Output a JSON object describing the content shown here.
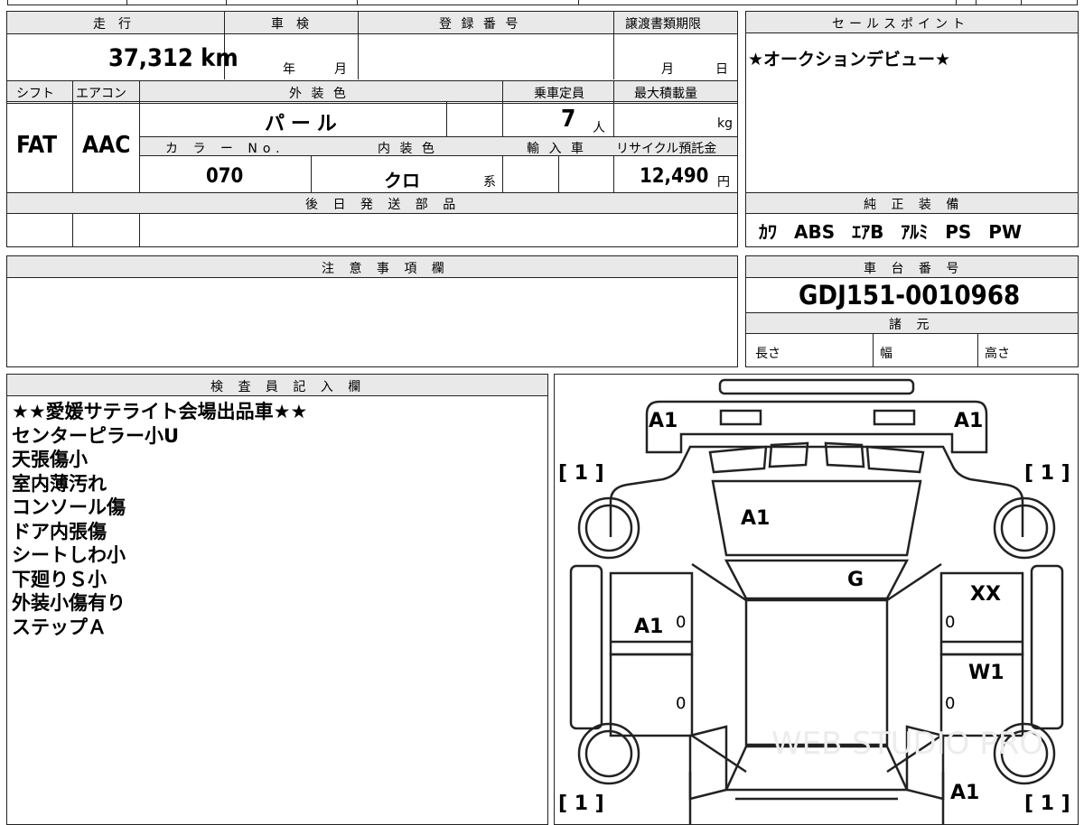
{
  "top_row": {
    "mileage_label": "走　行",
    "mileage_value": "37,312 km",
    "shaken_label": "車　検",
    "shaken_year": "年",
    "shaken_month": "月",
    "reg_label": "登 録 番 号",
    "transfer_label": "譲渡書類期限",
    "transfer_month": "月",
    "transfer_day": "日"
  },
  "spec_row": {
    "shift_label": "シフト",
    "shift_value": "FAT",
    "ac_label": "エアコン",
    "ac_value": "AAC",
    "ext_color_label": "外 装 色",
    "ext_color_value": "パ ー ル",
    "capacity_label": "乗車定員",
    "capacity_value": "7",
    "capacity_unit": "人",
    "max_load_label": "最大積載量",
    "max_load_unit": "kg",
    "color_no_label": "カ ラ ー No.",
    "color_no_value": "070",
    "int_color_label": "内 装 色",
    "int_color_value": "クロ",
    "int_color_suffix": "系",
    "import_label": "輸 入 車",
    "recycle_label": "リサイクル預託金",
    "recycle_value": "12,490",
    "recycle_unit": "円"
  },
  "later_parts_label": "後 日 発 送 部 品",
  "sales_point": {
    "label": "セールスポイント",
    "text": "★オークションデビュー★"
  },
  "genuine_equipment": {
    "label": "純 正 装 備",
    "items": [
      "ｶﾜ",
      "ABS",
      "ｴｱB",
      "ｱﾙﾐ",
      "PS",
      "PW"
    ]
  },
  "caution_label": "注 意 事 項 欄",
  "chassis": {
    "label": "車 台 番 号",
    "value": "GDJ151-0010968"
  },
  "specs": {
    "label": "諸 元",
    "length_label": "長さ",
    "width_label": "幅",
    "height_label": "高さ"
  },
  "inspector": {
    "label": "検 査 員 記 入 欄",
    "lines": [
      "★★愛媛サテライト会場出品車★★",
      "センターピラー小U",
      "天張傷小",
      "室内薄汚れ",
      "コンソール傷",
      "ドア内張傷",
      "シートしわ小",
      "下廻りＳ小",
      "外装小傷有り",
      "ステップＡ"
    ]
  },
  "diagram": {
    "front_left": "A1",
    "front_right": "A1",
    "hood": "A1",
    "roof": "G",
    "left_front_door": "A1",
    "right_front_door": "XX",
    "right_rear_door": "W1",
    "rear_right": "A1",
    "tire_top_left": "[ 1 ]",
    "tire_top_right": "[ 1 ]",
    "tire_bottom_left": "[ 1 ]",
    "tire_bottom_right": "[ 1 ]",
    "door_zero_1": "0",
    "door_zero_2": "0",
    "door_zero_3": "0",
    "door_zero_4": "0",
    "watermark": "WEB STUDIO PRO"
  }
}
